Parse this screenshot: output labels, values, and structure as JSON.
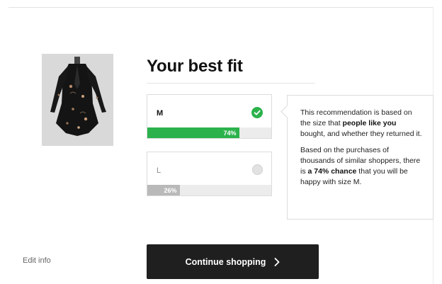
{
  "panel": {
    "title": "Your best fit",
    "edit_info_label": "Edit info",
    "continue_label": "Continue shopping"
  },
  "product": {
    "image_alt": "dark floral print dress"
  },
  "sizes": [
    {
      "label": "M",
      "percent": 74,
      "percent_label": "74%",
      "selected": true
    },
    {
      "label": "L",
      "percent": 26,
      "percent_label": "26%",
      "selected": false
    }
  ],
  "info": {
    "p1_start": "This recommendation is based on the size that ",
    "p1_bold": "people like you",
    "p1_end": " bought, and whether they returned it.",
    "p2_start": "Based on the purchases of thousands of similar shoppers, there is ",
    "p2_bold": "a 74% chance",
    "p2_end": " that you will be happy with size M."
  },
  "colors": {
    "accent_green": "#2bb24c",
    "button_dark": "#1f1f1f",
    "bar_gray": "#b9b9b9"
  },
  "icons": {
    "check": "check-circle-icon",
    "radio": "radio-empty-icon",
    "chevron": "chevron-right-icon"
  }
}
